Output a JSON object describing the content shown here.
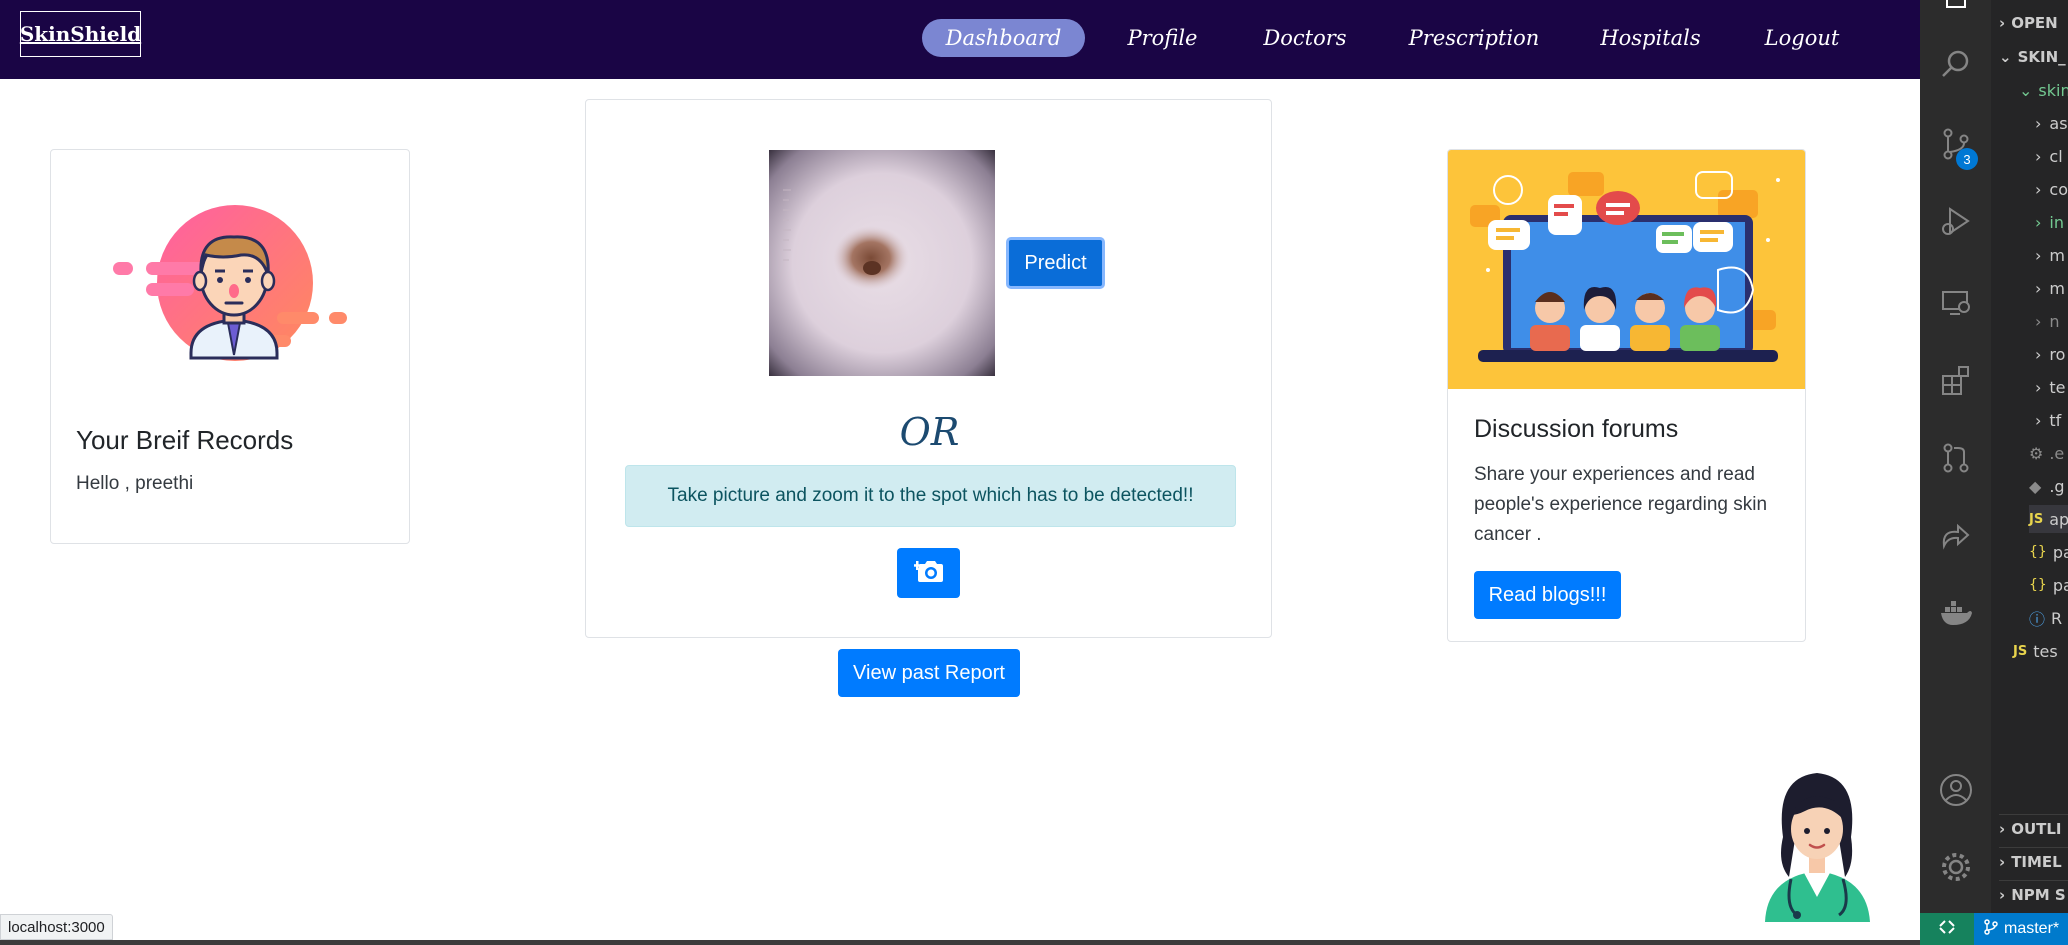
{
  "navbar": {
    "brand": "SkinShield",
    "items": [
      {
        "label": "Dashboard",
        "active": true
      },
      {
        "label": "Profile",
        "active": false
      },
      {
        "label": "Doctors",
        "active": false
      },
      {
        "label": "Prescription",
        "active": false
      },
      {
        "label": "Hospitals",
        "active": false
      },
      {
        "label": "Logout",
        "active": false
      }
    ]
  },
  "records_card": {
    "title": "Your Breif Records",
    "greeting": "Hello , preethi"
  },
  "predict_card": {
    "predict_label": "Predict",
    "or_text": "OR",
    "instruction": "Take picture and zoom it to the spot which has to be detected!!",
    "camera_icon": "camera-plus-icon"
  },
  "past_report_label": "View past Report",
  "forum_card": {
    "title": "Discussion forums",
    "text": "Share your experiences and read people's experience regarding skin cancer .",
    "button_label": "Read blogs!!!"
  },
  "browser_status_url": "localhost:3000",
  "vscode": {
    "scm_badge": "3",
    "explorer": {
      "open_editors": "OPEN",
      "project": "SKIN_",
      "folder": "skin",
      "entries": [
        "as",
        "cl",
        "co",
        "in",
        "m",
        "m",
        "n",
        "ro",
        "te",
        "tf",
        ".e",
        ".g",
        "ap",
        "pa",
        "pa",
        "R",
        "tes"
      ],
      "outline": "OUTLI",
      "timeline": "TIMEL",
      "npm": "NPM S"
    },
    "branch": "master*"
  },
  "colors": {
    "navbar_bg": "#1a0545",
    "active_nav": "#7b86d2",
    "primary": "#007bff",
    "alert_bg": "#d1ecf1",
    "alert_text": "#0c5460",
    "vscode_activity": "#2c2c2c",
    "vscode_sidebar": "#252526",
    "vscode_status": "#007acc"
  }
}
